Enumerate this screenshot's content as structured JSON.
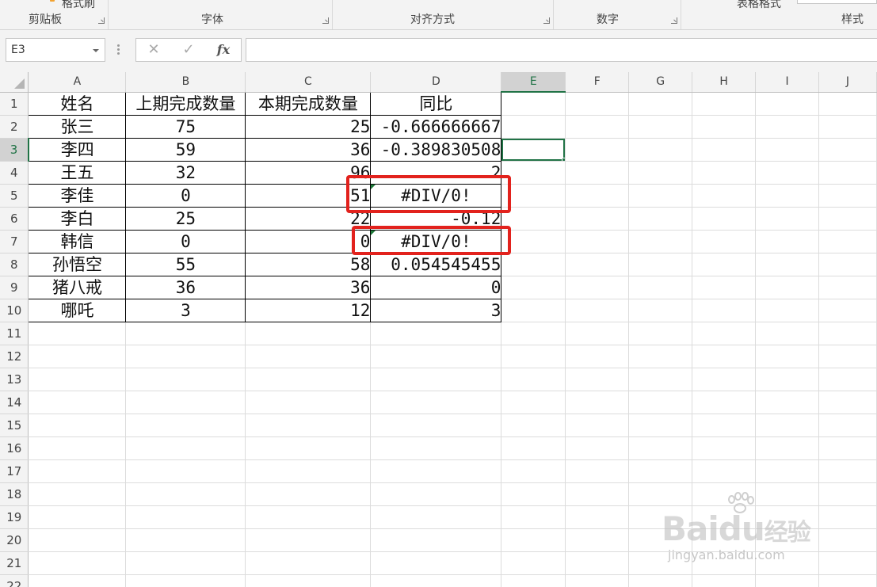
{
  "ribbon": {
    "groups": [
      "剪贴板",
      "字体",
      "对齐方式",
      "数字",
      "样式"
    ],
    "partial_top": [
      "格式刷",
      "表格格式"
    ]
  },
  "formula_bar": {
    "name_box": "E3",
    "cancel_icon": "close-icon",
    "enter_icon": "check-icon",
    "fx_label": "fx",
    "formula": ""
  },
  "sheet": {
    "columns": [
      "A",
      "B",
      "C",
      "D",
      "E",
      "F",
      "G",
      "H",
      "I",
      "J"
    ],
    "row_numbers": [
      "1",
      "2",
      "3",
      "4",
      "5",
      "6",
      "7",
      "8",
      "9",
      "10",
      "11",
      "12",
      "13",
      "14",
      "15",
      "16",
      "17",
      "18",
      "19",
      "20",
      "21",
      "22"
    ],
    "active_cell": "E3",
    "rows": [
      [
        "姓名",
        "上期完成数量",
        "本期完成数量",
        "同比"
      ],
      [
        "张三",
        "75",
        "25",
        "-0.666666667"
      ],
      [
        "李四",
        "59",
        "36",
        "-0.389830508"
      ],
      [
        "王五",
        "32",
        "96",
        "2"
      ],
      [
        "李佳",
        "0",
        "51",
        "#DIV/0!"
      ],
      [
        "李白",
        "25",
        "22",
        "-0.12"
      ],
      [
        "韩信",
        "0",
        "0",
        "#DIV/0!"
      ],
      [
        "孙悟空",
        "55",
        "58",
        "0.054545455"
      ],
      [
        "猪八戒",
        "36",
        "36",
        "0"
      ],
      [
        "哪吒",
        "3",
        "12",
        "3"
      ]
    ]
  },
  "annotation": {
    "color": "#e2221d"
  },
  "watermark": {
    "brand": "Bai",
    "brand2": "du",
    "brand3": "经验",
    "url": "jingyan.baidu.com"
  }
}
